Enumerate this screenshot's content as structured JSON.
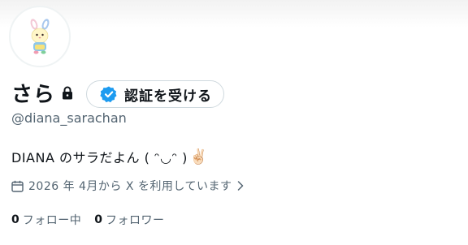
{
  "profile": {
    "display_name": "さら",
    "handle": "@diana_sarachan",
    "verify_button_label": "認証を受ける",
    "bio_text": "DIANA のサラだよん ( ᵔ◡ᵔ )",
    "bio_emoji": "✌🏻",
    "joined_text": "2026 年 4月から X を利用しています",
    "following_count": "0",
    "following_label": "フォロー中",
    "followers_count": "0",
    "followers_label": "フォロワー"
  },
  "icons": {
    "lock": "lock-icon",
    "verify": "verified-badge-icon",
    "calendar": "calendar-icon",
    "chevron": "chevron-right-icon",
    "avatar": "bunny-avatar"
  },
  "colors": {
    "verified_blue": "#1d9bf0",
    "secondary_text": "#536471",
    "primary_text": "#0f1419",
    "border": "#cfd9de"
  }
}
